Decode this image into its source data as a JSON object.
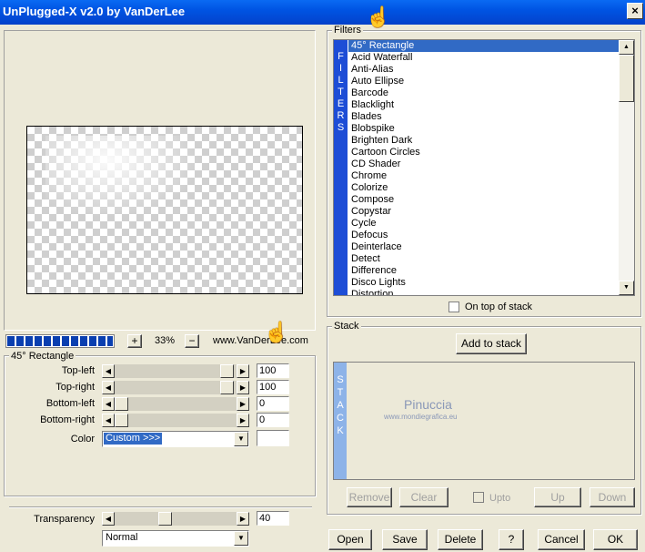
{
  "window": {
    "title": "UnPlugged-X v2.0 by VanDerLee",
    "close_label": "×"
  },
  "preview": {
    "zoom": "33%",
    "zoom_plus": "+",
    "zoom_minus": "−",
    "website": "www.VanDerLee.com",
    "progress": 1.0
  },
  "params": {
    "group_title": "45° Rectangle",
    "rows": [
      {
        "label": "Top-left",
        "value": "100"
      },
      {
        "label": "Top-right",
        "value": "100"
      },
      {
        "label": "Bottom-left",
        "value": "0"
      },
      {
        "label": "Bottom-right",
        "value": "0"
      }
    ],
    "color_label": "Color",
    "color_value": "Custom >>>",
    "transparency_label": "Transparency",
    "transparency_value": "40",
    "blend_mode": "Normal"
  },
  "filters": {
    "title": "Filters",
    "strip": [
      "F",
      "I",
      "L",
      "T",
      "E",
      "R",
      "S"
    ],
    "items": [
      "45° Rectangle",
      "Acid Waterfall",
      "Anti-Alias",
      "Auto Ellipse",
      "Barcode",
      "Blacklight",
      "Blades",
      "Blobspike",
      "Brighten Dark",
      "Cartoon Circles",
      "CD Shader",
      "Chrome",
      "Colorize",
      "Compose",
      "Copystar",
      "Cycle",
      "Defocus",
      "Deinterlace",
      "Detect",
      "Difference",
      "Disco Lights",
      "Distortion"
    ],
    "on_top_label": "On top of stack"
  },
  "stack": {
    "title": "Stack",
    "add_label": "Add to stack",
    "strip": [
      "S",
      "T",
      "A",
      "C",
      "K"
    ],
    "watermark_1": "Pinuccia",
    "watermark_2": "www.mondiegrafica.eu",
    "remove_label": "Remove",
    "clear_label": "Clear",
    "upto_label": "Upto",
    "up_label": "Up",
    "down_label": "Down"
  },
  "footer": {
    "open": "Open",
    "save": "Save",
    "delete": "Delete",
    "help": "?",
    "cancel": "Cancel",
    "ok": "OK"
  },
  "colors": {
    "accent": "#316ac5",
    "strip": "#1d4dd6",
    "dialog": "#ece9d8"
  }
}
